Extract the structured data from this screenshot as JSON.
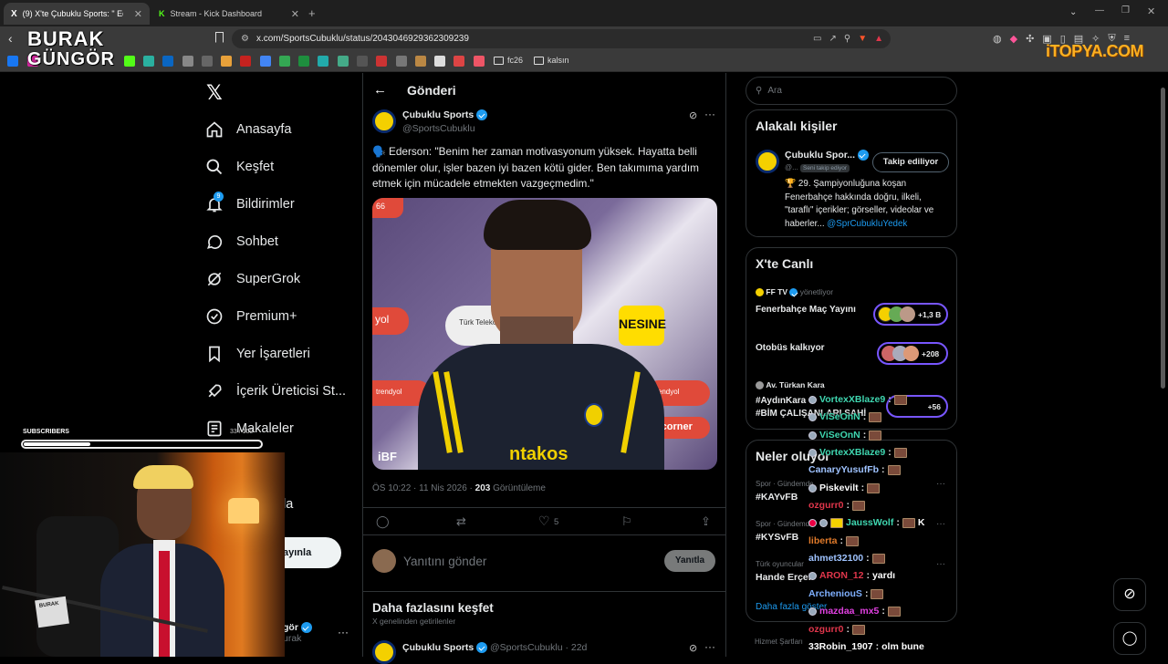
{
  "browser": {
    "tabs": [
      {
        "title": "(9) X'te Çubuklu Sports: \" Ed",
        "active": true
      },
      {
        "title": "Stream - Kick Dashboard",
        "active": false
      }
    ],
    "url": "x.com/SportsCubuklu/status/2043046929362309239",
    "bookmarks": [
      "fc26",
      "kalsın"
    ]
  },
  "overlay": {
    "logo_line1": "BURAK",
    "logo_line2": "GÜNGÖR",
    "sponsor": "iTOPYA.COM",
    "subscribers_label": "SUBSCRIBERS",
    "subscribers_count": "33 / 100",
    "subscribers_progress": 0.28
  },
  "sidebar": {
    "items": [
      {
        "label": "Anasayfa",
        "icon": "home-icon"
      },
      {
        "label": "Keşfet",
        "icon": "search-icon"
      },
      {
        "label": "Bildirimler",
        "icon": "bell-icon",
        "badge": "9"
      },
      {
        "label": "Sohbet",
        "icon": "chat-icon"
      },
      {
        "label": "SuperGrok",
        "icon": "grok-icon"
      },
      {
        "label": "Premium+",
        "icon": "premium-icon"
      },
      {
        "label": "Yer İşaretleri",
        "icon": "bookmark-icon"
      },
      {
        "label": "İçerik Üreticisi St...",
        "icon": "rocket-icon"
      },
      {
        "label": "Makaleler",
        "icon": "article-icon"
      }
    ],
    "partial_item": "la",
    "post_button": "ayınla",
    "account_name": "gör",
    "account_handle": "urak"
  },
  "post": {
    "header": "Gönderi",
    "author": "Çubuklu Sports",
    "handle": "@SportsCubuklu",
    "text": "🗣️ Ederson: \"Benim her zaman motivasyonum yüksek. Hayatta belli dönemler olur, işler bazen iyi bazen kötü gider. Ben takımıma yardım etmek için mücadele etmekten vazgeçmedim.\"",
    "time": "ÖS 10:22 · 11 Nis 2026 · ",
    "views": "203",
    "views_label": " Görüntüleme",
    "likes": "5",
    "reply_placeholder": "Yanıtını gönder",
    "reply_button": "Yanıtla",
    "discover_title": "Daha fazlasını keşfet",
    "discover_sub": "X genelinden getirilenler",
    "next_author": "Çubuklu Sports",
    "next_handle": "@SportsCubuklu · 22d"
  },
  "right": {
    "search_placeholder": "Ara",
    "related_title": "Alakalı kişiler",
    "related_name": "Çubuklu Spor...",
    "related_handle": "@...",
    "related_follows_you": "Seni takip ediyor",
    "related_follow_btn": "Takip ediliyor",
    "related_bio": "🏆 29. Şampiyonluğuna koşan Fenerbahçe hakkında doğru, ilkeli, \"taraflı\" içerikler; görseller, videolar ve haberler... ",
    "related_bio_link": "@SprCubukluYedek",
    "live_title": "X'te Canlı",
    "live_host": "FF TV",
    "live_host_role": "yönetliyor",
    "live_items": [
      {
        "title": "Fenerbahçe Maç Yayını",
        "count": "+1,3 B"
      },
      {
        "title": "Otobüs kalkıyor",
        "count": "+208"
      },
      {
        "title": "#AydınKara",
        "count": "+56"
      }
    ],
    "live_third_host": "Av. Türkan Kara",
    "live_third_sub": "#BİM ÇALIŞANLARI SAHİ",
    "trends_title": "Neler oluyor",
    "trends": [
      {
        "cat": "Spor · Gündemde",
        "tag": "#KAYvFB"
      },
      {
        "cat": "Spor · Gündemde",
        "tag": "#KYSvFB"
      },
      {
        "cat": "Türk oyuncular",
        "tag": "Hande Erçel"
      }
    ],
    "trends_more": "Daha fazla göster",
    "footer": "Hizmet Şartları"
  },
  "chat": [
    {
      "user": "VortexXBlaze9",
      "msg": "",
      "color": "#3fd6b0"
    },
    {
      "user": "ViSeOnN",
      "msg": "",
      "color": "#3fd6b0"
    },
    {
      "user": "ViSeOnN",
      "msg": "",
      "color": "#3fd6b0"
    },
    {
      "user": "VortexXBlaze9",
      "msg": "",
      "color": "#3fd6b0"
    },
    {
      "user": "CanaryYusufFb",
      "msg": "",
      "color": "#9fc3ff"
    },
    {
      "user": "Piskevilt",
      "msg": "",
      "color": "#ffffff"
    },
    {
      "user": "ozgurr0",
      "msg": "",
      "color": "#e0364b"
    },
    {
      "user": "JaussWolf",
      "msg": "K",
      "color": "#3fd6b0"
    },
    {
      "user": "liberta",
      "msg": "",
      "color": "#e07a2a"
    },
    {
      "user": "ahmet32100",
      "msg": "",
      "color": "#9fc3ff"
    },
    {
      "user": "ARON_12",
      "msg": "yardı",
      "color": "#e0364b"
    },
    {
      "user": "ArcheniouS",
      "msg": "",
      "color": "#7fb0ff"
    },
    {
      "user": "mazdaa_mx5",
      "msg": "",
      "color": "#e040e0"
    },
    {
      "user": "ozgurr0",
      "msg": "",
      "color": "#e0364b"
    },
    {
      "user": "33Robin_1907",
      "msg": "olm bune",
      "color": "#ffffff"
    }
  ]
}
